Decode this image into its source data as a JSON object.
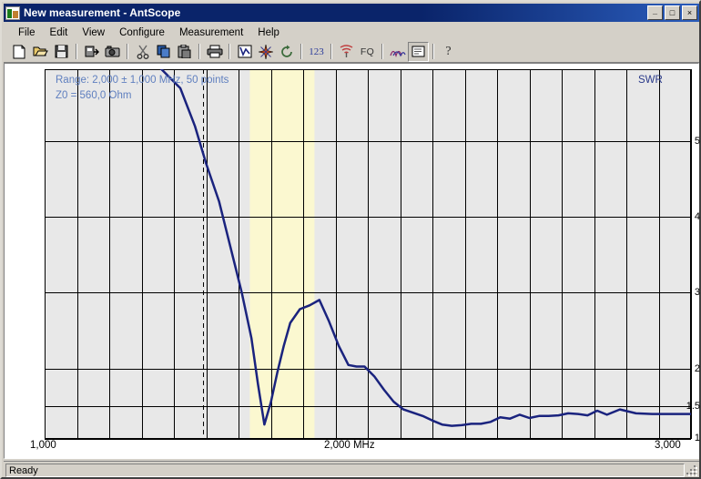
{
  "window": {
    "title": "New measurement - AntScope",
    "icon": "antscope-icon",
    "buttons": {
      "minimize": "_",
      "maximize": "□",
      "close": "×"
    }
  },
  "menu": {
    "items": [
      {
        "label": "File"
      },
      {
        "label": "Edit"
      },
      {
        "label": "View"
      },
      {
        "label": "Configure"
      },
      {
        "label": "Measurement"
      },
      {
        "label": "Help"
      }
    ]
  },
  "toolbar": {
    "buttons": [
      {
        "name": "new-icon",
        "glyph": "📄"
      },
      {
        "name": "open-icon",
        "glyph": "📂"
      },
      {
        "name": "save-icon",
        "glyph": "💾"
      },
      {
        "name": "export-icon",
        "glyph": "⬛"
      },
      {
        "name": "camera-icon",
        "glyph": "📷"
      },
      {
        "name": "cut-icon",
        "glyph": "✂"
      },
      {
        "name": "copy-icon",
        "glyph": "⧉"
      },
      {
        "name": "paste-icon",
        "glyph": "📋"
      },
      {
        "name": "print-icon",
        "glyph": "🖨"
      },
      {
        "name": "chart-icon",
        "glyph": "✓"
      },
      {
        "name": "smith-chart-icon",
        "glyph": "✳"
      },
      {
        "name": "refresh-icon",
        "glyph": "↻"
      },
      {
        "name": "numbers-icon",
        "glyph": "123"
      },
      {
        "name": "antenna-icon",
        "glyph": "📡"
      },
      {
        "name": "fq-icon",
        "glyph": "FQ"
      },
      {
        "name": "multi-curve-icon",
        "glyph": "∿"
      },
      {
        "name": "notes-icon",
        "glyph": "▤"
      },
      {
        "name": "help-icon",
        "glyph": "?"
      }
    ]
  },
  "status": {
    "text": "Ready",
    "grip": "resize-grip"
  },
  "chart_data": {
    "type": "line",
    "title": "",
    "annotations": [
      {
        "name": "range-line-1",
        "text": "Range: 2,000 ± 1,000 MHz, 50 points",
        "color": "#5f7fbf"
      },
      {
        "name": "range-line-2",
        "text": "Z0 = 560,0 Ohm",
        "color": "#5f7fbf"
      },
      {
        "name": "series-label",
        "text": "SWR",
        "color": "#2a3a8a"
      }
    ],
    "xlabel": "MHz",
    "ylabel": "SWR",
    "xlim": [
      1000,
      3000
    ],
    "ylim": [
      1,
      5.6
    ],
    "xticks": [
      {
        "value": 1000,
        "label": "1,000"
      },
      {
        "value": 2000,
        "label": "2,000 MHz"
      },
      {
        "value": 3000,
        "label": "3,000"
      }
    ],
    "yticks": [
      {
        "value": 5,
        "label": "5"
      },
      {
        "value": 4,
        "label": "4"
      },
      {
        "value": 3,
        "label": "3"
      },
      {
        "value": 2,
        "label": "2"
      },
      {
        "value": 1.5,
        "label": "1.5"
      },
      {
        "value": 1,
        "label": "1"
      }
    ],
    "grid": true,
    "grid_color": "#000000",
    "plot_bg": "#e8e8e8",
    "band_color": "#fbf8d0",
    "bands": [
      {
        "name": "marker-band",
        "x0": 1635,
        "x1": 1835
      }
    ],
    "cursors": [
      {
        "name": "dashed-cursor",
        "x": 1490,
        "style": "dashed"
      }
    ],
    "series": [
      {
        "name": "SWR",
        "color": "#1a237e",
        "width": 2.5,
        "x": [
          1000,
          1350,
          1420,
          1465,
          1500,
          1540,
          1575,
          1610,
          1640,
          1660,
          1680,
          1700,
          1720,
          1740,
          1760,
          1790,
          1820,
          1850,
          1880,
          1910,
          1940,
          1965,
          1990,
          2020,
          2050,
          2080,
          2110,
          2140,
          2170,
          2200,
          2230,
          2260,
          2290,
          2320,
          2350,
          2380,
          2410,
          2440,
          2470,
          2500,
          2530,
          2560,
          2590,
          2620,
          2650,
          2680,
          2710,
          2740,
          2780,
          2830,
          2880,
          2930,
          3000
        ],
        "y": [
          6.2,
          6.0,
          5.7,
          5.2,
          4.7,
          4.2,
          3.6,
          3.0,
          2.4,
          1.8,
          1.22,
          1.55,
          1.95,
          2.3,
          2.6,
          2.78,
          2.83,
          2.9,
          2.62,
          2.3,
          2.05,
          2.03,
          2.03,
          1.9,
          1.72,
          1.56,
          1.45,
          1.4,
          1.35,
          1.28,
          1.22,
          1.2,
          1.21,
          1.23,
          1.23,
          1.26,
          1.33,
          1.31,
          1.37,
          1.32,
          1.35,
          1.35,
          1.36,
          1.39,
          1.38,
          1.36,
          1.43,
          1.37,
          1.45,
          1.39,
          1.38,
          1.38,
          1.38
        ]
      }
    ]
  }
}
